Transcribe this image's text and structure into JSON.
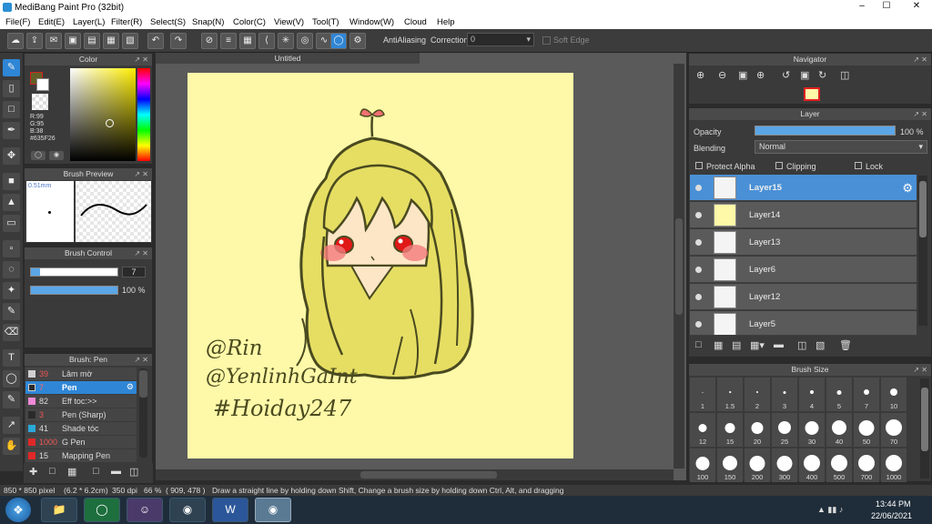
{
  "window": {
    "title": "MediBang Paint Pro (32bit)"
  },
  "menu": [
    "File(F)",
    "Edit(E)",
    "Layer(L)",
    "Filter(R)",
    "Select(S)",
    "Snap(N)",
    "Color(C)",
    "View(V)",
    "Tool(T)",
    "Window(W)",
    "Cloud",
    "Help"
  ],
  "toolbar": {
    "antialiasing": "AntiAliasing",
    "correction_label": "Correction",
    "correction_value": "0",
    "soft_edge": "Soft Edge"
  },
  "color_panel": {
    "title": "Color",
    "r": "R:99",
    "g": "G:95",
    "b": "B:38",
    "hex": "#635F26",
    "main_color": "#635F26"
  },
  "brush_preview": {
    "title": "Brush Preview",
    "size": "0.51mm"
  },
  "brush_control": {
    "title": "Brush Control",
    "size": "7",
    "opacity": "100 %"
  },
  "brush_panel": {
    "title": "Brush: Pen",
    "items": [
      {
        "n": "39",
        "label": "Lâm mờ",
        "color": "#d0d0d0"
      },
      {
        "n": "7",
        "label": "Pen",
        "color": "#2a2a2a"
      },
      {
        "n": "82",
        "label": "Eff toc:>>",
        "color": "#f08ad8"
      },
      {
        "n": "3",
        "label": "Pen (Sharp)",
        "color": "#2a2a2a"
      },
      {
        "n": "41",
        "label": "Shade tóc",
        "color": "#2aa8d8"
      },
      {
        "n": "1000",
        "label": "G Pen",
        "color": "#e02828"
      },
      {
        "n": "15",
        "label": "Mapping Pen",
        "color": "#e02828"
      }
    ]
  },
  "canvas": {
    "tab": "Untitled",
    "drawing_text": [
      "@Rin",
      "@YenlinhGaInt",
      "#Hoiday247"
    ]
  },
  "navigator": {
    "title": "Navigator"
  },
  "layer_panel": {
    "title": "Layer",
    "opacity_label": "Opacity",
    "opacity_value": "100 %",
    "blending_label": "Blending",
    "blending_value": "Normal",
    "protect_alpha": "Protect Alpha",
    "clipping": "Clipping",
    "lock": "Lock",
    "layers": [
      "Layer15",
      "Layer14",
      "Layer13",
      "Layer6",
      "Layer12",
      "Layer5"
    ]
  },
  "brush_size": {
    "title": "Brush Size",
    "sizes": [
      "1",
      "1.5",
      "2",
      "3",
      "4",
      "5",
      "7",
      "10",
      "12",
      "15",
      "20",
      "25",
      "30",
      "40",
      "50",
      "70",
      "100",
      "150",
      "200",
      "300",
      "400",
      "500",
      "700",
      "1000"
    ]
  },
  "status": {
    "size": "850 * 850 pixel",
    "cm": "(6.2 * 6.2cm)",
    "dpi": "350 dpi",
    "zoom": "66 %",
    "coords": "( 909, 478 )",
    "hint": "Draw a straight line by holding down Shift, Change a brush size by holding down Ctrl, Alt, and dragging"
  },
  "taskbar": {
    "time": "13:44 PM",
    "date": "22/06/2021"
  }
}
